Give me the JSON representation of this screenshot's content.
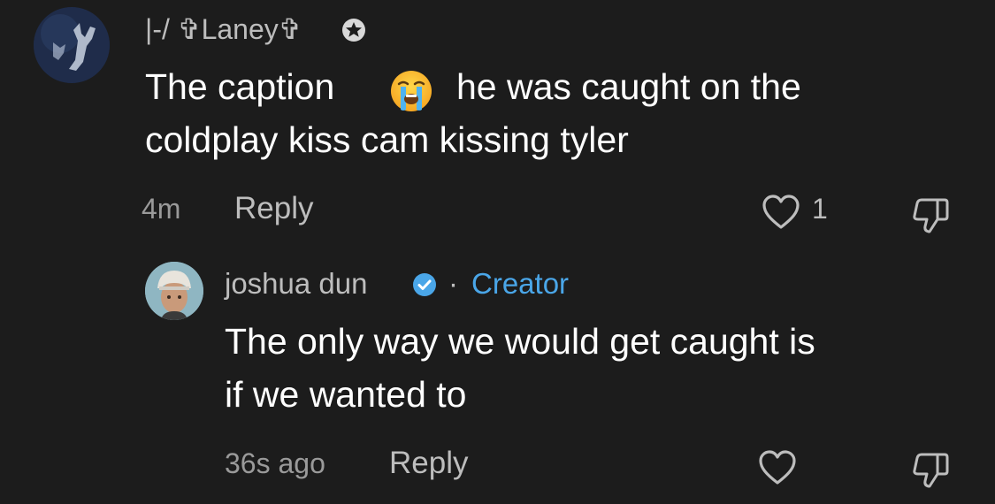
{
  "comment": {
    "username": "|-/ ✞Laney✞",
    "badge_icon": "star-badge-icon",
    "text_line1_a": "The caption",
    "emoji": "loudly-crying-face",
    "text_line1_b": "he was caught on the",
    "text_line2": "coldplay kiss cam kissing tyler",
    "time": "4m",
    "reply_label": "Reply",
    "likes": "1"
  },
  "reply": {
    "username": "joshua dun",
    "verified_color": "#4aa6e8",
    "separator": "·",
    "creator_label": "Creator",
    "text_line1": "The only way we would get caught is",
    "text_line2": "if we wanted to",
    "time": "36s ago",
    "reply_label": "Reply"
  },
  "colors": {
    "background": "#1c1c1c",
    "primary_text": "#ffffff",
    "secondary_text": "#bdbdbd",
    "accent": "#4aa6e8"
  }
}
